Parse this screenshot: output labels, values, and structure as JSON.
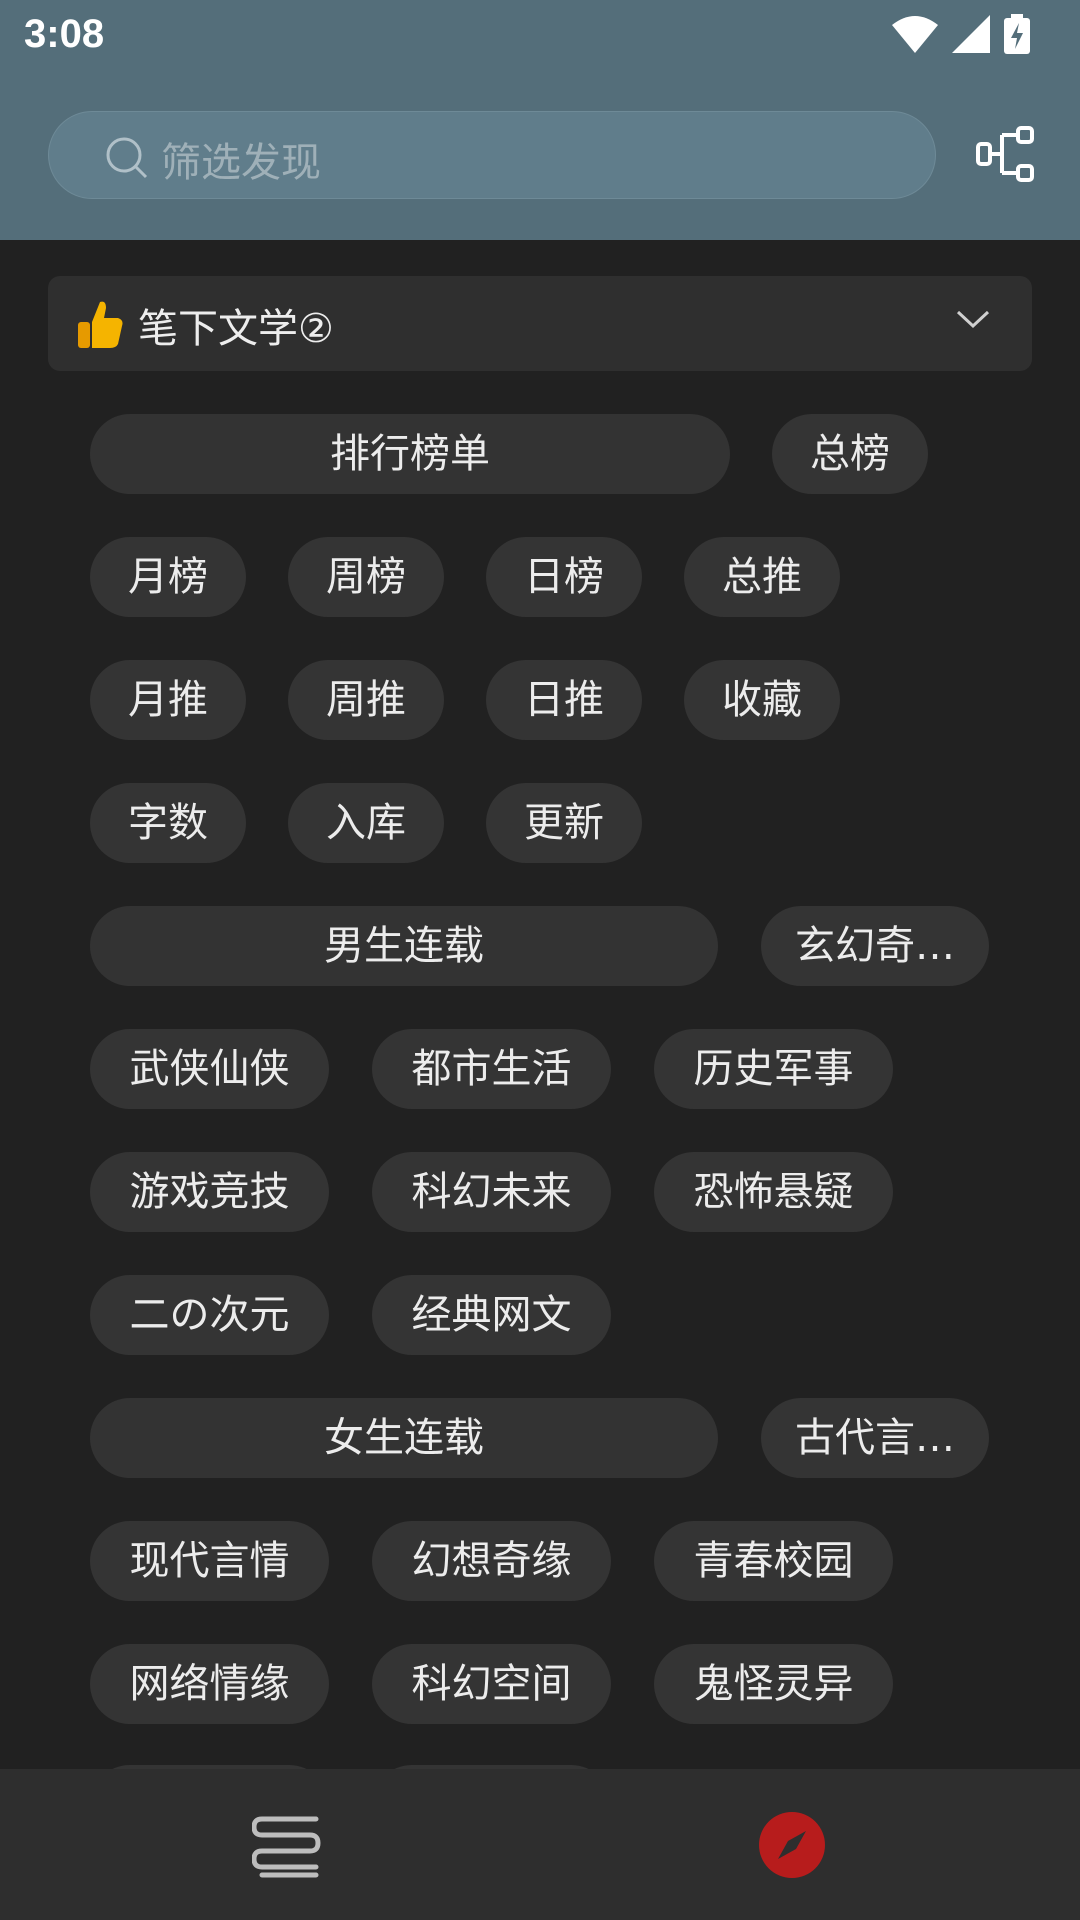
{
  "status_bar": {
    "time": "3:08"
  },
  "search": {
    "placeholder": "筛选发现"
  },
  "source": {
    "title": "笔下文学②"
  },
  "rank_group": {
    "title": "排行榜单",
    "items": [
      "总榜",
      "月榜",
      "周榜",
      "日榜",
      "总推",
      "月推",
      "周推",
      "日推",
      "收藏",
      "字数",
      "入库",
      "更新"
    ]
  },
  "male_group": {
    "title": "男生连载",
    "items": [
      "玄幻奇…",
      "武侠仙侠",
      "都市生活",
      "历史军事",
      "游戏竞技",
      "科幻未来",
      "恐怖悬疑",
      "二の次元",
      "经典网文"
    ]
  },
  "female_group": {
    "title": "女生连载",
    "items": [
      "古代言…",
      "现代言情",
      "幻想奇缘",
      "青春校园",
      "网络情缘",
      "科幻空间",
      "鬼怪灵异"
    ]
  },
  "colors": {
    "header": "#546e7a",
    "background": "#212121",
    "accent": "#c62828"
  }
}
